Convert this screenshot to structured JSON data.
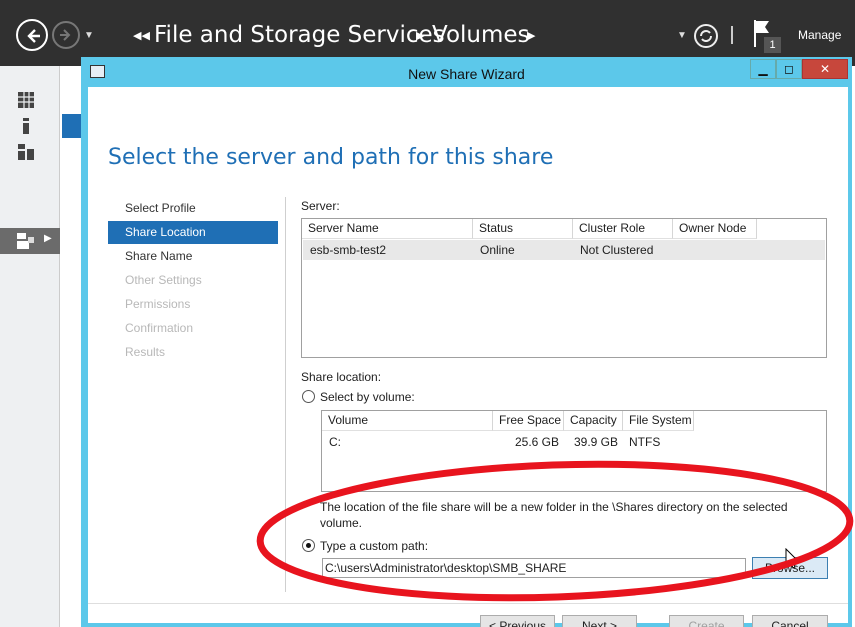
{
  "server_manager": {
    "breadcrumbs": [
      "File and Storage Services",
      "Volumes"
    ],
    "manage_label": "Manage",
    "notification_count": "1"
  },
  "wizard": {
    "title": "New Share Wizard",
    "heading": "Select the server and path for this share",
    "steps": [
      {
        "label": "Select Profile",
        "state": "normal"
      },
      {
        "label": "Share Location",
        "state": "active"
      },
      {
        "label": "Share Name",
        "state": "normal"
      },
      {
        "label": "Other Settings",
        "state": "disabled"
      },
      {
        "label": "Permissions",
        "state": "disabled"
      },
      {
        "label": "Confirmation",
        "state": "disabled"
      },
      {
        "label": "Results",
        "state": "disabled"
      }
    ],
    "server_label": "Server:",
    "server_table": {
      "columns": [
        "Server Name",
        "Status",
        "Cluster Role",
        "Owner Node"
      ],
      "rows": [
        [
          "esb-smb-test2",
          "Online",
          "Not Clustered",
          ""
        ]
      ]
    },
    "share_location_label": "Share location:",
    "select_by_volume_label": "Select by volume:",
    "volume_table": {
      "columns": [
        "Volume",
        "Free Space",
        "Capacity",
        "File System"
      ],
      "rows": [
        [
          "C:",
          "25.6 GB",
          "39.9 GB",
          "NTFS"
        ]
      ]
    },
    "volume_note_line1": "The location of the file share will be a new folder in the \\Shares directory on the selected",
    "volume_note_line2": "volume.",
    "custom_path_label": "Type a custom path:",
    "custom_path_value": "C:\\users\\Administrator\\desktop\\SMB_SHARE",
    "selected_option": "custom_path",
    "buttons": {
      "browse": "Browse...",
      "previous": "< Previous",
      "next": "Next >",
      "create": "Create",
      "cancel": "Cancel"
    }
  },
  "colors": {
    "accent": "#1f6fb5",
    "window_chrome": "#5cc8ea",
    "annotation": "#e8141e"
  }
}
